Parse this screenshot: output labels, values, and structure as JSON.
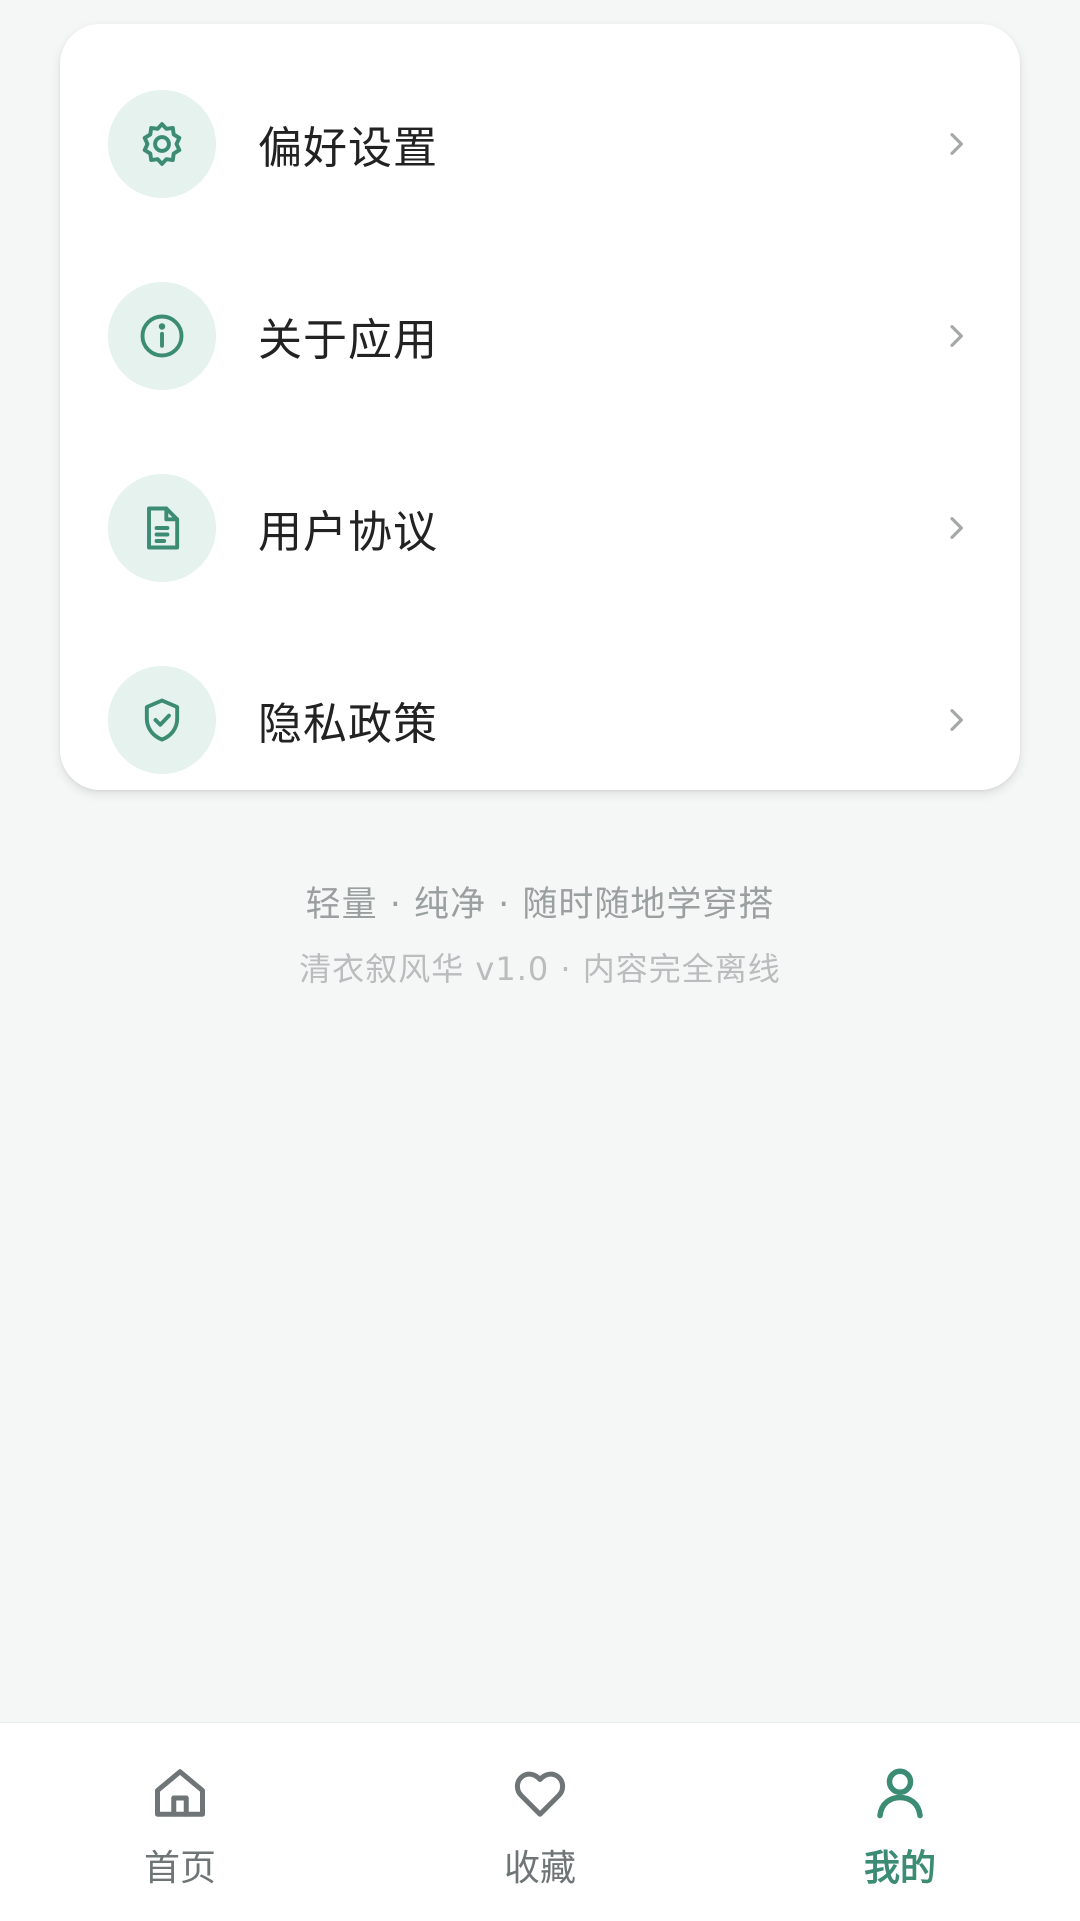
{
  "menu": {
    "items": [
      {
        "label": "偏好设置",
        "icon": "gear-icon"
      },
      {
        "label": "关于应用",
        "icon": "info-icon"
      },
      {
        "label": "用户协议",
        "icon": "document-icon"
      },
      {
        "label": "隐私政策",
        "icon": "shield-check-icon"
      }
    ]
  },
  "footer": {
    "slogan": "轻量 · 纯净 · 随时随地学穿搭",
    "version": "清衣叙风华 v1.0 · 内容完全离线"
  },
  "bottom_nav": {
    "tabs": [
      {
        "label": "首页",
        "icon": "home-icon",
        "active": false
      },
      {
        "label": "收藏",
        "icon": "heart-icon",
        "active": false
      },
      {
        "label": "我的",
        "icon": "user-icon",
        "active": true
      }
    ]
  },
  "colors": {
    "accent": "#3c8c74",
    "icon_bg": "#e6f2ee",
    "background": "#f5f7f7",
    "inactive": "#6f7576"
  }
}
